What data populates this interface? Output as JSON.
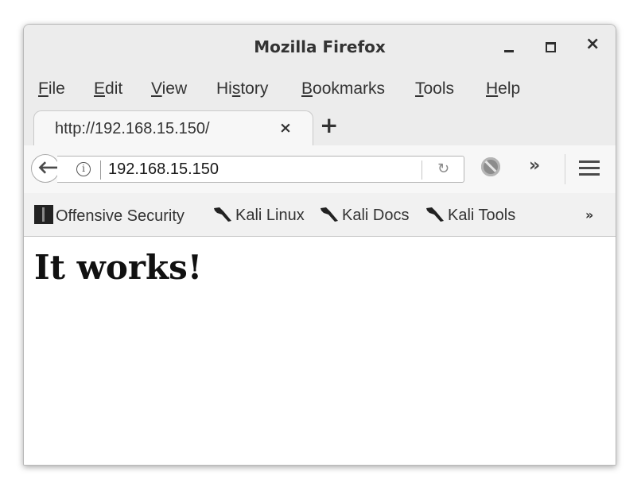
{
  "window": {
    "title": "Mozilla Firefox",
    "controls": [
      "minimize-icon",
      "maximize-icon",
      "close-icon"
    ]
  },
  "menu": {
    "items": [
      {
        "label": "File",
        "accesskey": "F"
      },
      {
        "label": "Edit",
        "accesskey": "E"
      },
      {
        "label": "View",
        "accesskey": "V"
      },
      {
        "label": "History",
        "accesskey": "s"
      },
      {
        "label": "Bookmarks",
        "accesskey": "B"
      },
      {
        "label": "Tools",
        "accesskey": "T"
      },
      {
        "label": "Help",
        "accesskey": "H"
      }
    ]
  },
  "tabs": [
    {
      "label": "http://192.168.15.150/",
      "active": true
    }
  ],
  "navbar": {
    "url": "192.168.15.150",
    "icons": [
      "back-arrow-icon",
      "info-icon",
      "reload-icon",
      "noscript-icon",
      "overflow-chevron-icon",
      "hamburger-menu-icon"
    ]
  },
  "bookmarks": {
    "items": [
      {
        "label": "Offensive Security",
        "icon": "offsec-icon"
      },
      {
        "label": "Kali Linux",
        "icon": "kali-dragon-icon"
      },
      {
        "label": "Kali Docs",
        "icon": "kali-dragon-icon"
      },
      {
        "label": "Kali Tools",
        "icon": "kali-dragon-icon"
      }
    ]
  },
  "page": {
    "heading": "It works!"
  }
}
